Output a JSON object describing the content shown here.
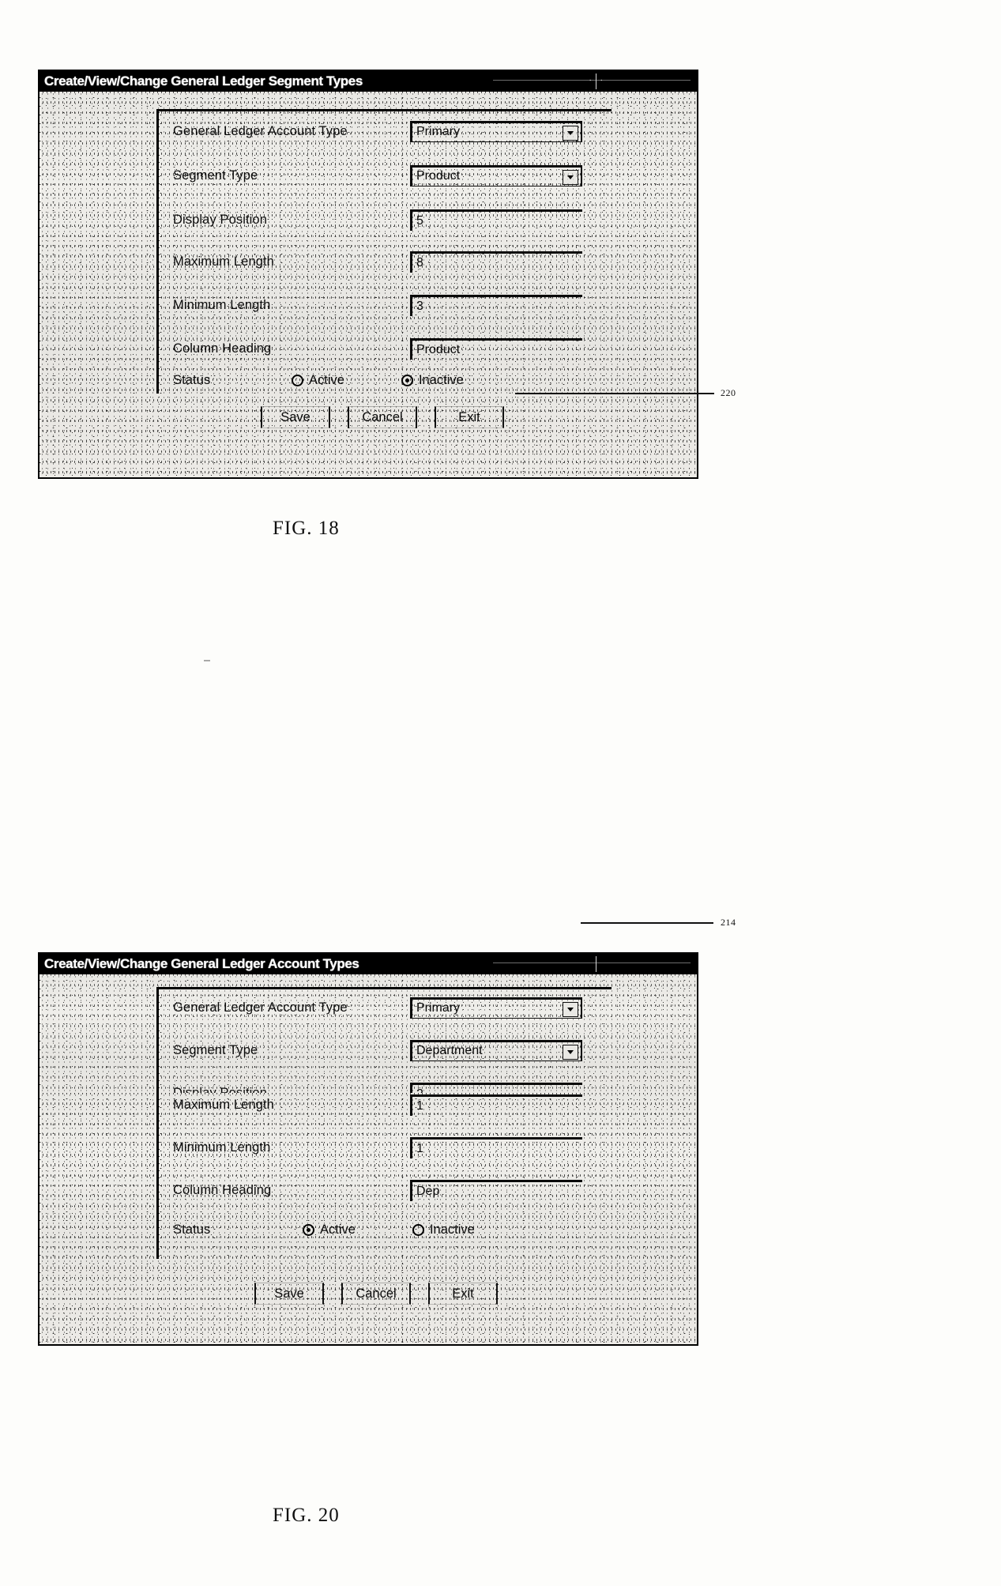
{
  "page": {
    "figures": [
      {
        "id": "fig18",
        "caption": "FIG.  18",
        "reference_numeral": "220",
        "window": {
          "title": "Create/View/Change General Ledger Segment Types"
        },
        "fields": [
          {
            "label": "General Ledger Account Type",
            "value": "Primary",
            "type": "dropdown"
          },
          {
            "label": "Segment Type",
            "value": "Product",
            "type": "dropdown"
          },
          {
            "label": "Display Position",
            "value": "5",
            "type": "text"
          },
          {
            "label": "Maximum Length",
            "value": "8",
            "type": "text"
          },
          {
            "label": "Minimum Length",
            "value": "3",
            "type": "text"
          },
          {
            "label": "Column Heading",
            "value": "Product",
            "type": "text"
          }
        ],
        "status": {
          "label": "Status",
          "options": [
            {
              "label": "Active",
              "selected": false
            },
            {
              "label": "Inactive",
              "selected": true
            }
          ]
        },
        "buttons": [
          {
            "label": "Save"
          },
          {
            "label": "Cancel"
          },
          {
            "label": "Exit"
          }
        ]
      },
      {
        "id": "fig20",
        "caption": "FIG.  20",
        "reference_numeral": "214",
        "window": {
          "title": "Create/View/Change General Ledger Account Types"
        },
        "fields": [
          {
            "label": "General Ledger Account Type",
            "value": "Primary",
            "type": "dropdown"
          },
          {
            "label": "Segment Type",
            "value": "Department",
            "type": "dropdown"
          },
          {
            "label": "Display Position",
            "value": "2",
            "type": "text"
          },
          {
            "label": "Maximum Length",
            "value": "1",
            "type": "text"
          },
          {
            "label": "Minimum Length",
            "value": "1",
            "type": "text"
          },
          {
            "label": "Column Heading",
            "value": "Dep",
            "type": "text"
          }
        ],
        "status": {
          "label": "Status",
          "options": [
            {
              "label": "Active",
              "selected": true
            },
            {
              "label": "Inactive",
              "selected": false
            }
          ]
        },
        "buttons": [
          {
            "label": "Save"
          },
          {
            "label": "Cancel"
          },
          {
            "label": "Exit"
          }
        ]
      }
    ],
    "icons": {
      "dropdown_arrow": "chevron-down-icon"
    },
    "colors": {
      "titlebar_background": "#000000",
      "titlebar_text": "#ffffff",
      "window_background": "#eceae6",
      "border": "#000000",
      "text": "#0b0b0b"
    }
  }
}
